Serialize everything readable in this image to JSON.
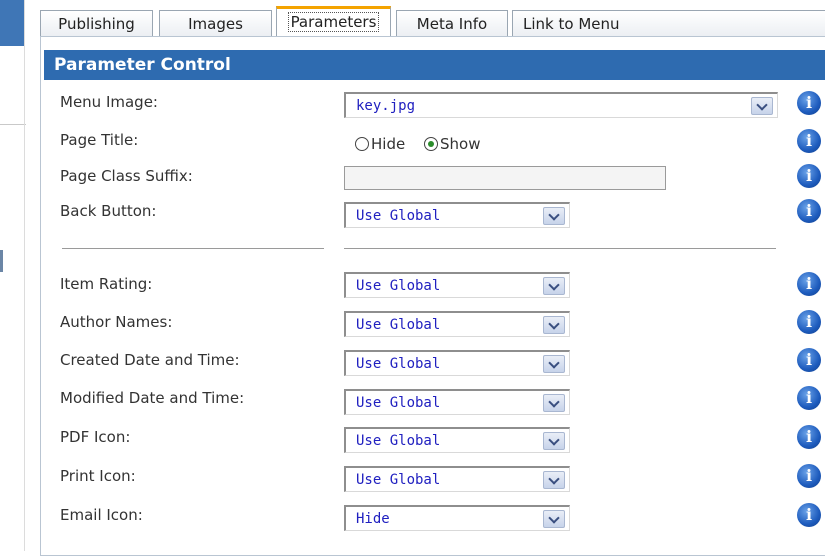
{
  "tabs": [
    {
      "label": "Publishing",
      "active": false
    },
    {
      "label": "Images",
      "active": false
    },
    {
      "label": "Parameters",
      "active": true
    },
    {
      "label": "Meta Info",
      "active": false
    },
    {
      "label": "Link to Menu",
      "active": false
    }
  ],
  "panel": {
    "title": "Parameter Control",
    "header_color": "#2e6bb0"
  },
  "fields": {
    "menu_image": {
      "label": "Menu Image:",
      "value": "key.jpg"
    },
    "page_title": {
      "label": "Page Title:",
      "options": [
        "Hide",
        "Show"
      ],
      "selected": "Show"
    },
    "page_class_suffix": {
      "label": "Page Class Suffix:",
      "value": ""
    },
    "back_button": {
      "label": "Back Button:",
      "value": "Use Global"
    },
    "item_rating": {
      "label": "Item Rating:",
      "value": "Use Global"
    },
    "author_names": {
      "label": "Author Names:",
      "value": "Use Global"
    },
    "created_date": {
      "label": "Created Date and Time:",
      "value": "Use Global"
    },
    "modified_date": {
      "label": "Modified Date and Time:",
      "value": "Use Global"
    },
    "pdf_icon": {
      "label": "PDF Icon:",
      "value": "Use Global"
    },
    "print_icon": {
      "label": "Print Icon:",
      "value": "Use Global"
    },
    "email_icon": {
      "label": "Email Icon:",
      "value": "Hide"
    }
  },
  "icons": {
    "info": "info-icon",
    "dropdown": "chevron-down-icon"
  },
  "info_glyph": "i"
}
